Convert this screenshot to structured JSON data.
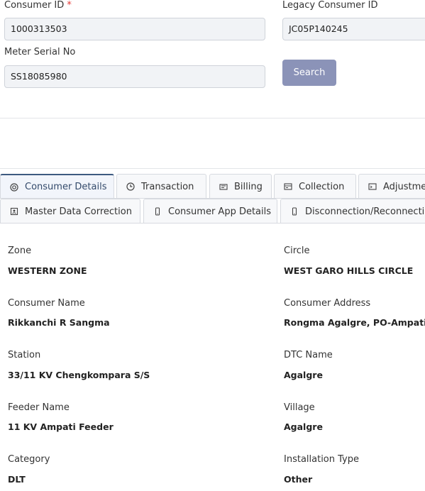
{
  "search": {
    "consumer_id_label": "Consumer ID",
    "required_mark": "*",
    "consumer_id_value": "1000313503",
    "legacy_id_label": "Legacy Consumer ID",
    "legacy_id_value": "JC05P140245",
    "meter_label": "Meter Serial No",
    "meter_value": "SS18085980",
    "search_button": "Search"
  },
  "tabs_row1": [
    {
      "label": "Consumer Details",
      "icon": "target-icon",
      "active": true
    },
    {
      "label": "Transaction",
      "icon": "clock-icon"
    },
    {
      "label": "Billing",
      "icon": "bill-icon"
    },
    {
      "label": "Collection",
      "icon": "collection-icon"
    },
    {
      "label": "Adjustme",
      "icon": "adjustment-icon"
    }
  ],
  "tabs_row2": [
    {
      "label": "Master Data Correction",
      "icon": "id-card-icon"
    },
    {
      "label": "Consumer App Details",
      "icon": "mobile-icon"
    },
    {
      "label": "Disconnection/Reconnectio",
      "icon": "mobile-icon"
    }
  ],
  "details": {
    "zone": {
      "label": "Zone",
      "value": "WESTERN ZONE"
    },
    "circle": {
      "label": "Circle",
      "value": "WEST GARO HILLS CIRCLE"
    },
    "consumer_name": {
      "label": "Consumer Name",
      "value": "Rikkanchi R Sangma"
    },
    "consumer_address": {
      "label": "Consumer Address",
      "value": "Rongma Agalgre, PO-Ampati"
    },
    "station": {
      "label": "Station",
      "value": "33/11 KV Chengkompara S/S"
    },
    "dtc_name": {
      "label": "DTC Name",
      "value": "Agalgre"
    },
    "feeder_name": {
      "label": "Feeder Name",
      "value": "11 KV Ampati Feeder"
    },
    "village": {
      "label": "Village",
      "value": "Agalgre"
    },
    "category": {
      "label": "Category",
      "value": "DLT"
    },
    "installation_type": {
      "label": "Installation Type",
      "value": "Other"
    }
  }
}
